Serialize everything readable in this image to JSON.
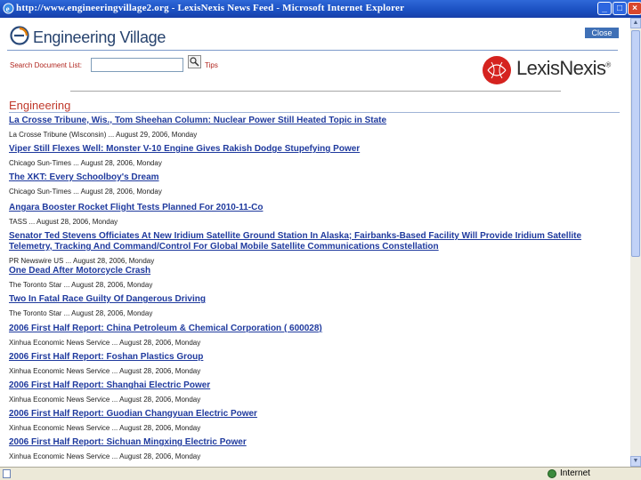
{
  "window": {
    "title": "http://www.engineeringvillage2.org - LexisNexis News Feed - Microsoft Internet Explorer",
    "minimize": "_",
    "maximize": "□",
    "close": "×"
  },
  "header": {
    "logo_text": "Engineering Village",
    "close_button": "Close"
  },
  "search": {
    "label": "Search Document List:",
    "value": "",
    "tips": "Tips"
  },
  "lexisnexis": {
    "logo_text": "LexisNexis",
    "registered": "®"
  },
  "section": {
    "title": "Engineering"
  },
  "articles": [
    {
      "title": "La Crosse Tribune, Wis., Tom Sheehan Column: Nuclear Power Still Heated Topic in State",
      "source": "La Crosse Tribune (Wisconsin)",
      "date": "August 29, 2006",
      "day": "Monday"
    },
    {
      "title": "Viper Still Flexes Well: Monster V-10 Engine Gives Rakish Dodge Stupefying Power",
      "source": "Chicago Sun-Times",
      "date": "August 28, 2006",
      "day": "Monday"
    },
    {
      "title": "The XKT: Every Schoolboy's Dream",
      "source": "Chicago Sun-Times",
      "date": "August 28, 2006",
      "day": "Monday"
    },
    {
      "title": "Angara Booster Rocket Flight Tests Planned For 2010-11-Co",
      "source": "TASS",
      "date": "August 28, 2006",
      "day": "Monday"
    },
    {
      "title": "Senator Ted Stevens Officiates At New Iridium Satellite Ground Station In Alaska; Fairbanks-Based Facility Will Provide Iridium Satellite",
      "title2": "Telemetry, Tracking And Command/Control For Global Mobile Satellite Communications Constellation",
      "source": "PR Newswire US",
      "date": "August 28, 2006",
      "day": "Monday"
    },
    {
      "title": "One Dead After Motorcycle Crash",
      "source": "The Toronto Star",
      "date": "August 28, 2006",
      "day": "Monday"
    },
    {
      "title": "Two In Fatal Race Guilty Of Dangerous Driving",
      "source": "The Toronto Star",
      "date": "August 28, 2006",
      "day": "Monday"
    },
    {
      "title": "2006 First Half Report: China Petroleum & Chemical Corporation ( 600028)",
      "source": "Xinhua Economic News Service",
      "date": "August 28, 2006",
      "day": "Monday"
    },
    {
      "title": "2006 First Half Report: Foshan Plastics Group",
      "source": "Xinhua Economic News Service",
      "date": "August 28, 2006",
      "day": "Monday"
    },
    {
      "title": "2006 First Half Report: Shanghai Electric Power",
      "source": "Xinhua Economic News Service",
      "date": "August 28, 2006",
      "day": "Monday"
    },
    {
      "title": "2006 First Half Report: Guodian Changyuan Electric Power",
      "source": "Xinhua Economic News Service",
      "date": "August 28, 2006",
      "day": "Monday"
    },
    {
      "title": "2006 First Half Report: Sichuan Mingxing Electric Power",
      "source": "Xinhua Economic News Service",
      "date": "August 28, 2006",
      "day": "Monday"
    }
  ],
  "status": {
    "zone": "Internet"
  }
}
